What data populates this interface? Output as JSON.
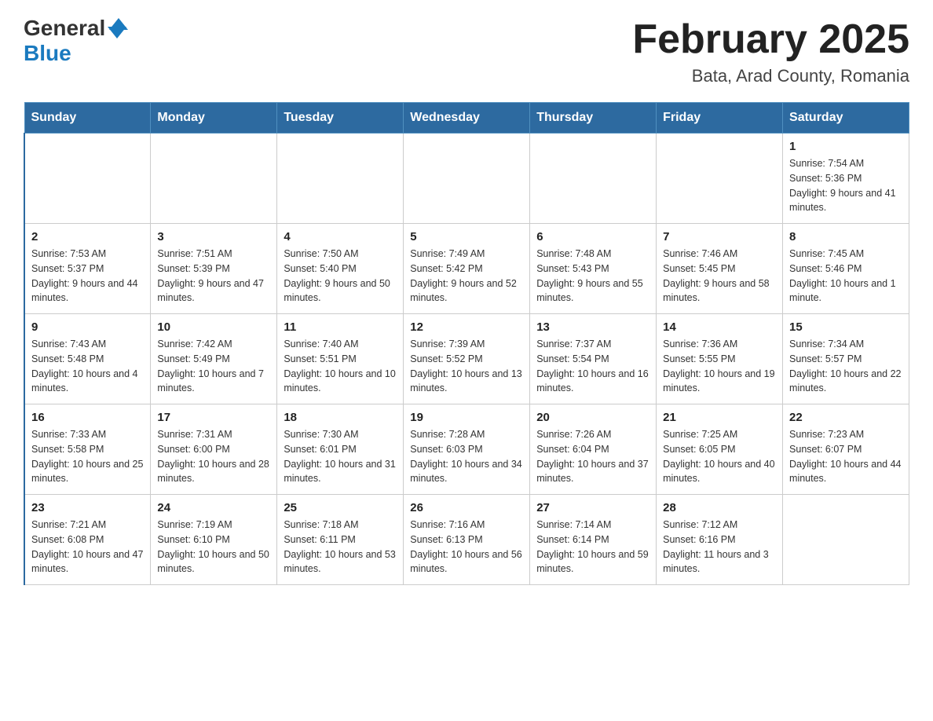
{
  "logo": {
    "general": "General",
    "blue": "Blue"
  },
  "title": "February 2025",
  "location": "Bata, Arad County, Romania",
  "days_of_week": [
    "Sunday",
    "Monday",
    "Tuesday",
    "Wednesday",
    "Thursday",
    "Friday",
    "Saturday"
  ],
  "weeks": [
    [
      {
        "day": "",
        "info": ""
      },
      {
        "day": "",
        "info": ""
      },
      {
        "day": "",
        "info": ""
      },
      {
        "day": "",
        "info": ""
      },
      {
        "day": "",
        "info": ""
      },
      {
        "day": "",
        "info": ""
      },
      {
        "day": "1",
        "info": "Sunrise: 7:54 AM\nSunset: 5:36 PM\nDaylight: 9 hours and 41 minutes."
      }
    ],
    [
      {
        "day": "2",
        "info": "Sunrise: 7:53 AM\nSunset: 5:37 PM\nDaylight: 9 hours and 44 minutes."
      },
      {
        "day": "3",
        "info": "Sunrise: 7:51 AM\nSunset: 5:39 PM\nDaylight: 9 hours and 47 minutes."
      },
      {
        "day": "4",
        "info": "Sunrise: 7:50 AM\nSunset: 5:40 PM\nDaylight: 9 hours and 50 minutes."
      },
      {
        "day": "5",
        "info": "Sunrise: 7:49 AM\nSunset: 5:42 PM\nDaylight: 9 hours and 52 minutes."
      },
      {
        "day": "6",
        "info": "Sunrise: 7:48 AM\nSunset: 5:43 PM\nDaylight: 9 hours and 55 minutes."
      },
      {
        "day": "7",
        "info": "Sunrise: 7:46 AM\nSunset: 5:45 PM\nDaylight: 9 hours and 58 minutes."
      },
      {
        "day": "8",
        "info": "Sunrise: 7:45 AM\nSunset: 5:46 PM\nDaylight: 10 hours and 1 minute."
      }
    ],
    [
      {
        "day": "9",
        "info": "Sunrise: 7:43 AM\nSunset: 5:48 PM\nDaylight: 10 hours and 4 minutes."
      },
      {
        "day": "10",
        "info": "Sunrise: 7:42 AM\nSunset: 5:49 PM\nDaylight: 10 hours and 7 minutes."
      },
      {
        "day": "11",
        "info": "Sunrise: 7:40 AM\nSunset: 5:51 PM\nDaylight: 10 hours and 10 minutes."
      },
      {
        "day": "12",
        "info": "Sunrise: 7:39 AM\nSunset: 5:52 PM\nDaylight: 10 hours and 13 minutes."
      },
      {
        "day": "13",
        "info": "Sunrise: 7:37 AM\nSunset: 5:54 PM\nDaylight: 10 hours and 16 minutes."
      },
      {
        "day": "14",
        "info": "Sunrise: 7:36 AM\nSunset: 5:55 PM\nDaylight: 10 hours and 19 minutes."
      },
      {
        "day": "15",
        "info": "Sunrise: 7:34 AM\nSunset: 5:57 PM\nDaylight: 10 hours and 22 minutes."
      }
    ],
    [
      {
        "day": "16",
        "info": "Sunrise: 7:33 AM\nSunset: 5:58 PM\nDaylight: 10 hours and 25 minutes."
      },
      {
        "day": "17",
        "info": "Sunrise: 7:31 AM\nSunset: 6:00 PM\nDaylight: 10 hours and 28 minutes."
      },
      {
        "day": "18",
        "info": "Sunrise: 7:30 AM\nSunset: 6:01 PM\nDaylight: 10 hours and 31 minutes."
      },
      {
        "day": "19",
        "info": "Sunrise: 7:28 AM\nSunset: 6:03 PM\nDaylight: 10 hours and 34 minutes."
      },
      {
        "day": "20",
        "info": "Sunrise: 7:26 AM\nSunset: 6:04 PM\nDaylight: 10 hours and 37 minutes."
      },
      {
        "day": "21",
        "info": "Sunrise: 7:25 AM\nSunset: 6:05 PM\nDaylight: 10 hours and 40 minutes."
      },
      {
        "day": "22",
        "info": "Sunrise: 7:23 AM\nSunset: 6:07 PM\nDaylight: 10 hours and 44 minutes."
      }
    ],
    [
      {
        "day": "23",
        "info": "Sunrise: 7:21 AM\nSunset: 6:08 PM\nDaylight: 10 hours and 47 minutes."
      },
      {
        "day": "24",
        "info": "Sunrise: 7:19 AM\nSunset: 6:10 PM\nDaylight: 10 hours and 50 minutes."
      },
      {
        "day": "25",
        "info": "Sunrise: 7:18 AM\nSunset: 6:11 PM\nDaylight: 10 hours and 53 minutes."
      },
      {
        "day": "26",
        "info": "Sunrise: 7:16 AM\nSunset: 6:13 PM\nDaylight: 10 hours and 56 minutes."
      },
      {
        "day": "27",
        "info": "Sunrise: 7:14 AM\nSunset: 6:14 PM\nDaylight: 10 hours and 59 minutes."
      },
      {
        "day": "28",
        "info": "Sunrise: 7:12 AM\nSunset: 6:16 PM\nDaylight: 11 hours and 3 minutes."
      },
      {
        "day": "",
        "info": ""
      }
    ]
  ]
}
